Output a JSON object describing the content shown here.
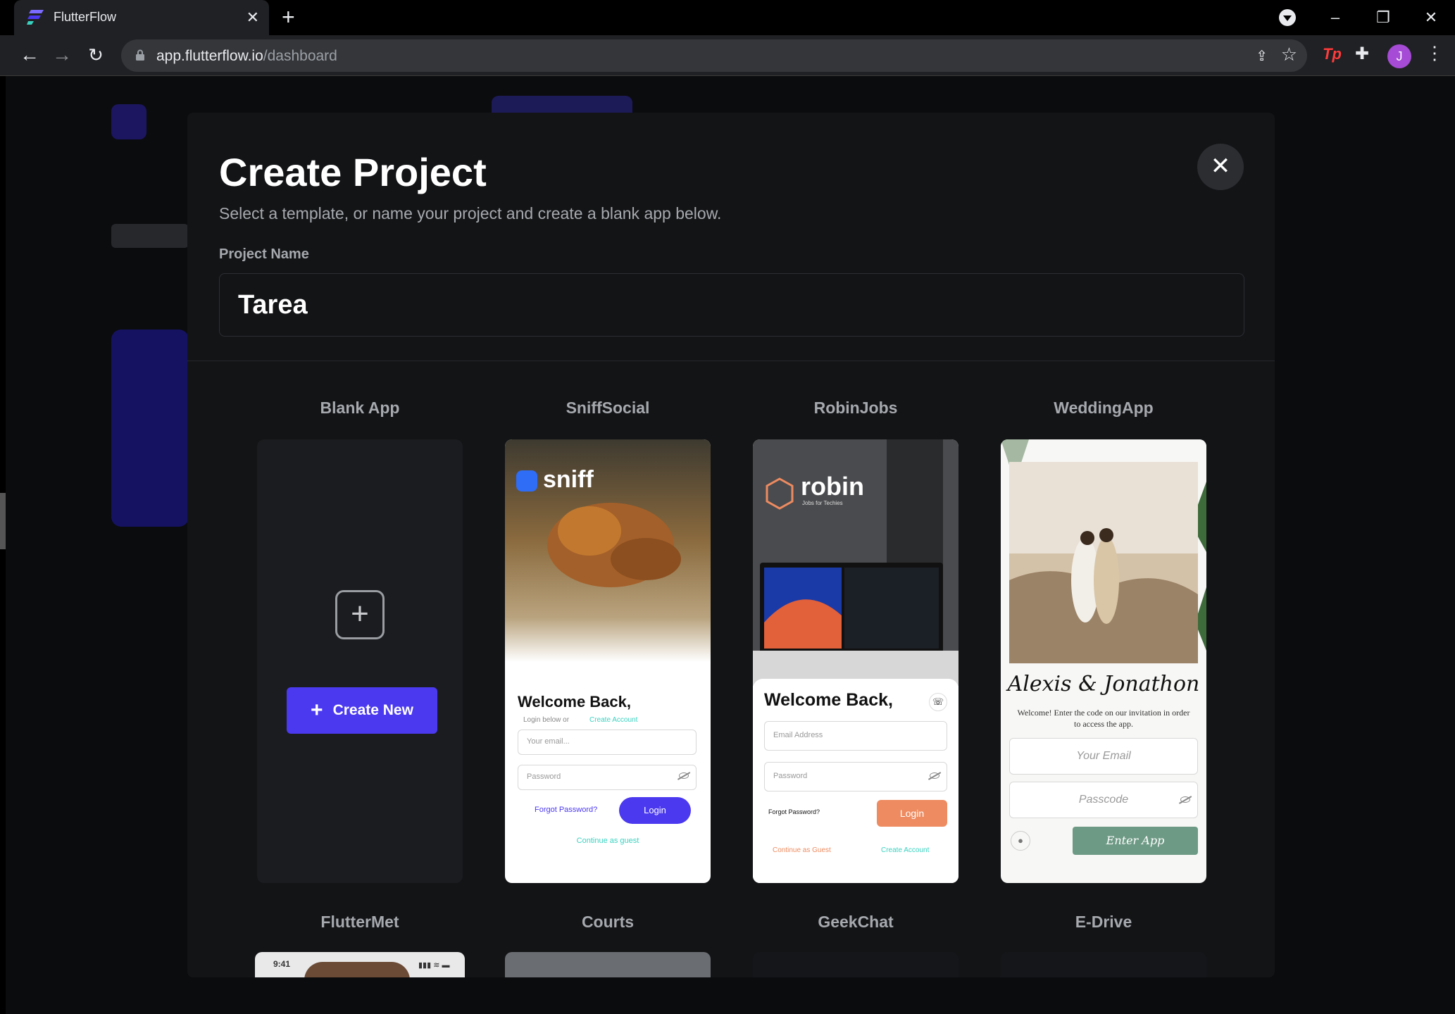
{
  "browser": {
    "tab_title": "FlutterFlow",
    "url_host": "app.flutterflow.io",
    "url_path": "/dashboard",
    "avatar_initial": "J",
    "extension_label": "Tp"
  },
  "modal": {
    "title": "Create Project",
    "subtitle": "Select a template, or name your project and create a blank app below.",
    "project_name_label": "Project Name",
    "project_name_value": "Tarea",
    "close_icon": "close-icon"
  },
  "templates": [
    {
      "name": "Blank App",
      "button_label": "Create New"
    },
    {
      "name": "SniffSocial"
    },
    {
      "name": "RobinJobs"
    },
    {
      "name": "WeddingApp"
    },
    {
      "name": "FlutterMet"
    },
    {
      "name": "Courts"
    },
    {
      "name": "GeekChat"
    },
    {
      "name": "E-Drive"
    }
  ],
  "sniff": {
    "logo": "sniff",
    "welcome": "Welcome Back,",
    "login_below": "Login below or",
    "create_account": "Create Account",
    "email_placeholder": "Your email...",
    "password_placeholder": "Password",
    "forgot": "Forgot Password?",
    "login": "Login",
    "guest": "Continue as guest"
  },
  "robin": {
    "logo": "robin",
    "tagline": "Jobs for Techies",
    "welcome": "Welcome Back,",
    "email_placeholder": "Email Address",
    "password_placeholder": "Password",
    "forgot": "Forgot Password?",
    "login": "Login",
    "guest": "Continue as Guest",
    "create_account": "Create Account"
  },
  "wedding": {
    "names": "Alexis & Jonathon",
    "message": "Welcome! Enter the code on our invitation in order to access the app.",
    "email_placeholder": "Your Email",
    "passcode_placeholder": "Passcode",
    "enter": "Enter App"
  },
  "fluttermet": {
    "status_time": "9:41"
  },
  "colors": {
    "accent": "#4b39ef",
    "robin_orange": "#ee8b60",
    "wedding_green": "#6d9a85",
    "sniff_teal": "#39d2c0"
  }
}
